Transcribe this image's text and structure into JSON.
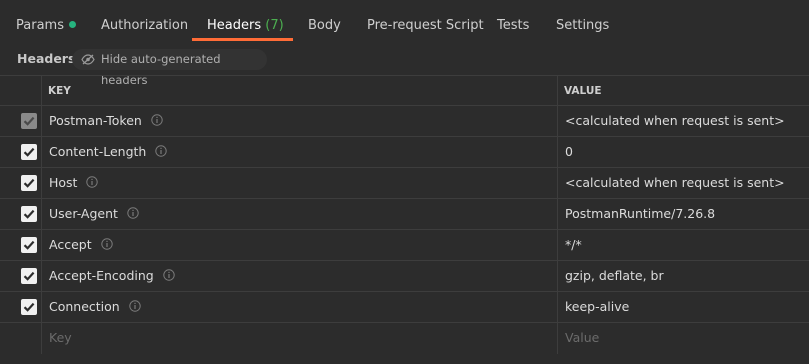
{
  "tabs": [
    {
      "label": "Params",
      "has_dot": true
    },
    {
      "label": "Authorization"
    },
    {
      "label": "Headers",
      "count": "(7)",
      "active": true
    },
    {
      "label": "Body"
    },
    {
      "label": "Pre-request Script"
    },
    {
      "label": "Tests"
    },
    {
      "label": "Settings"
    }
  ],
  "subheader": {
    "title": "Headers",
    "hide_button_label": "Hide auto-generated headers",
    "hide_button_icon": "eye-off-icon"
  },
  "table": {
    "columns": [
      "KEY",
      "VALUE"
    ],
    "rows": [
      {
        "key": "Postman-Token",
        "value": "<calculated when request is sent>",
        "checked": true,
        "disabled": true
      },
      {
        "key": "Content-Length",
        "value": "0",
        "checked": true
      },
      {
        "key": "Host",
        "value": "<calculated when request is sent>",
        "checked": true
      },
      {
        "key": "User-Agent",
        "value": "PostmanRuntime/7.26.8",
        "checked": true
      },
      {
        "key": "Accept",
        "value": "*/*",
        "checked": true
      },
      {
        "key": "Accept-Encoding",
        "value": "gzip, deflate, br",
        "checked": true
      },
      {
        "key": "Connection",
        "value": "keep-alive",
        "checked": true
      }
    ],
    "new_row": {
      "key_placeholder": "Key",
      "value_placeholder": "Value"
    }
  },
  "colors": {
    "accent": "#ff6c37",
    "count": "#4caf50",
    "dot": "#26b47f"
  }
}
